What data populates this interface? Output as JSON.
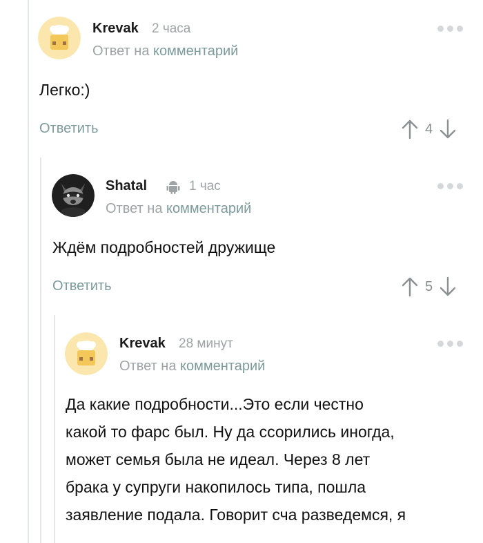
{
  "comments": [
    {
      "author": "Krevak",
      "time": "2 часа",
      "reply_prefix": "Ответ на",
      "reply_link": "комментарий",
      "text": "Легко:)",
      "reply_label": "Ответить",
      "rating": "4"
    },
    {
      "author": "Shatal",
      "time": "1 час",
      "reply_prefix": "Ответ на",
      "reply_link": "комментарий",
      "text": "Ждём подробностей дружище",
      "reply_label": "Ответить",
      "rating": "5"
    },
    {
      "author": "Krevak",
      "time": "28 минут",
      "reply_prefix": "Ответ на",
      "reply_link": "комментарий",
      "text_lines": [
        "Да какие подробности...Это если честно",
        "какой то фарс был. Ну да ссорились иногда,",
        "может семья была не идеал. Через 8 лет",
        "брака у супруги накопилось типа, пошла",
        "заявление подала. Говорит сча разведемся, я"
      ]
    }
  ],
  "colors": {
    "link": "#7c9a9b",
    "muted": "#9ea3a6",
    "thread_line": "#e4e6e7",
    "avatar_bg": "#fbe7ae"
  },
  "icons": {
    "menu": "more-dots-icon",
    "upvote": "arrow-up-icon",
    "downvote": "arrow-down-icon",
    "platform": "android-icon"
  }
}
